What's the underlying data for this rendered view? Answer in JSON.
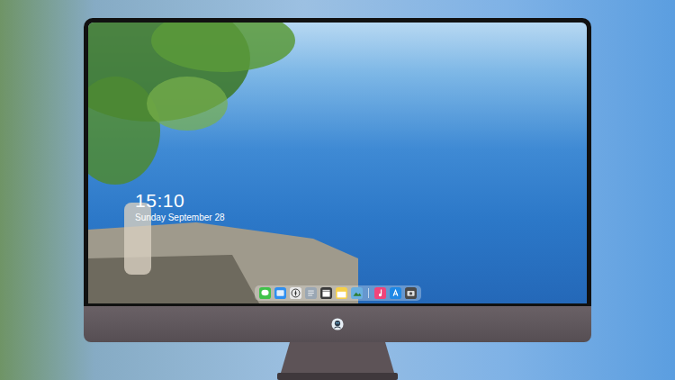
{
  "lock_screen": {
    "time": "15:10",
    "date": "Sunday September 28"
  },
  "dock": {
    "groups": [
      [
        {
          "kind": "messages",
          "color": "#3fc24a"
        },
        {
          "kind": "files",
          "color": "#2f8ff0"
        },
        {
          "kind": "browser",
          "color": "#e9e9e9"
        },
        {
          "kind": "reader",
          "color": "#9aa7b4"
        },
        {
          "kind": "video",
          "color": "#3a3a3a"
        },
        {
          "kind": "notes",
          "color": "#f5d04a"
        },
        {
          "kind": "photos",
          "color": "#6ab0e0"
        }
      ],
      [
        {
          "kind": "music",
          "color": "#f0447a"
        },
        {
          "kind": "store",
          "color": "#1e88e5"
        },
        {
          "kind": "camera",
          "color": "#4a4a4a"
        }
      ]
    ]
  }
}
